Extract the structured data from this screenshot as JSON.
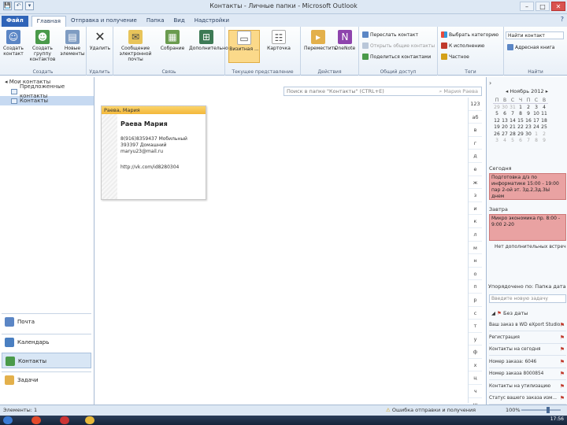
{
  "window": {
    "title": "Контакты - Личные папки - Microsoft Outlook",
    "quick_access": [
      "💾",
      "↶",
      "▾"
    ],
    "controls": [
      "–",
      "□",
      "✕"
    ]
  },
  "tabs": [
    {
      "label": "Файл",
      "kind": "file"
    },
    {
      "label": "Главная",
      "kind": "active"
    },
    {
      "label": "Отправка и получение",
      "kind": ""
    },
    {
      "label": "Папка",
      "kind": ""
    },
    {
      "label": "Вид",
      "kind": ""
    },
    {
      "label": "Надстройки",
      "kind": ""
    }
  ],
  "help_icon": "?",
  "ribbon": {
    "groups": [
      {
        "label": "Создать"
      },
      {
        "label": "Удалить"
      },
      {
        "label": "Связь"
      },
      {
        "label": "Текущее представление"
      },
      {
        "label": "Действия"
      },
      {
        "label": "Общий доступ"
      },
      {
        "label": "Теги"
      },
      {
        "label": "Найти"
      }
    ],
    "buttons": {
      "new_contact": "Создать контакт",
      "new_group": "Создать группу контактов",
      "new_items": "Новые элементы",
      "delete": "Удалить",
      "email": "Сообщение электронной почты",
      "meeting": "Собрание",
      "more": "Дополнительно",
      "card": "Визитная ...",
      "card2": "Карточка",
      "move": "Переместить",
      "onenote": "OneNote",
      "share": "Переслать контакт",
      "open_shared": "Открыть общие контакты",
      "share_contacts": "Поделиться контактами",
      "categorize": "Выбрать категорию",
      "followup": "К исполнению",
      "private": "Частное",
      "find_contact": "Найти контакт",
      "address_book": "Адресная книга"
    }
  },
  "nav": {
    "header": "Мои контакты",
    "items": [
      "Предложенные контакты",
      "Контакты"
    ],
    "buttons": [
      "Почта",
      "Календарь",
      "Контакты",
      "Задачи"
    ]
  },
  "search": {
    "placeholder": "Поиск в папке \"Контакты\" (CTRL+E)",
    "right": "Мария Раева"
  },
  "contact_card": {
    "header": "Раева, Мария",
    "name": "Раева Мария",
    "phone_mobile": "8(916)8359437 Мобильный",
    "phone_home": "393397 Домашний",
    "email": "maryu23@mail.ru",
    "url": "http://vk.com/id8280304"
  },
  "letters": [
    "123",
    "аб",
    "в",
    "г",
    "д",
    "е",
    "ж",
    "з",
    "и",
    "к",
    "л",
    "м",
    "н",
    "о",
    "п",
    "р",
    "с",
    "т",
    "у",
    "ф",
    "х",
    "ц",
    "ч",
    "ш"
  ],
  "calendar": {
    "title": "Ноябрь 2012",
    "weekdays": [
      "П",
      "В",
      "С",
      "Ч",
      "П",
      "С",
      "В"
    ],
    "weeks": [
      [
        "29",
        "30",
        "31",
        "1",
        "2",
        "3",
        "4"
      ],
      [
        "5",
        "6",
        "7",
        "8",
        "9",
        "10",
        "11"
      ],
      [
        "12",
        "13",
        "14",
        "15",
        "16",
        "17",
        "18"
      ],
      [
        "19",
        "20",
        "21",
        "22",
        "23",
        "24",
        "25"
      ],
      [
        "26",
        "27",
        "28",
        "29",
        "30",
        "1",
        "2"
      ],
      [
        "3",
        "4",
        "5",
        "6",
        "7",
        "8",
        "9"
      ]
    ]
  },
  "agenda": {
    "today_label": "Сегодня",
    "today_appt": "Подготовка д/з по информатике 15:00 - 19:00 пар 2-ой эт. 3д.2,Зд.3Ы днем",
    "tomorrow_label": "Завтра",
    "tomorrow_appt": "Микро экономика пр. 8:00 - 9:00 2-20",
    "more_note": "Нет дополнительных встреч"
  },
  "tasks": {
    "header": "Упорядочено по: Папка дата",
    "input_placeholder": "Введите новую задачу",
    "group": "Без даты",
    "items": [
      "Ваш заказ в WD eXport Studio...",
      "Регистрация",
      "Контакты на сегодня",
      "Номер заказа: 6046",
      "Номер заказа 8000854",
      "Контакты на утилизацию",
      "Статус вашего заказа изм..."
    ]
  },
  "status": {
    "left": "Элементы: 1",
    "mid": "Ошибка отправки и получения",
    "zoom": "100%"
  },
  "taskbar": {
    "clock": "17:56"
  },
  "colors": {
    "accent": "#2f64b8",
    "appt": "#e9a2a2",
    "card_header": "#f3b73a",
    "flag": "#c0392b"
  }
}
